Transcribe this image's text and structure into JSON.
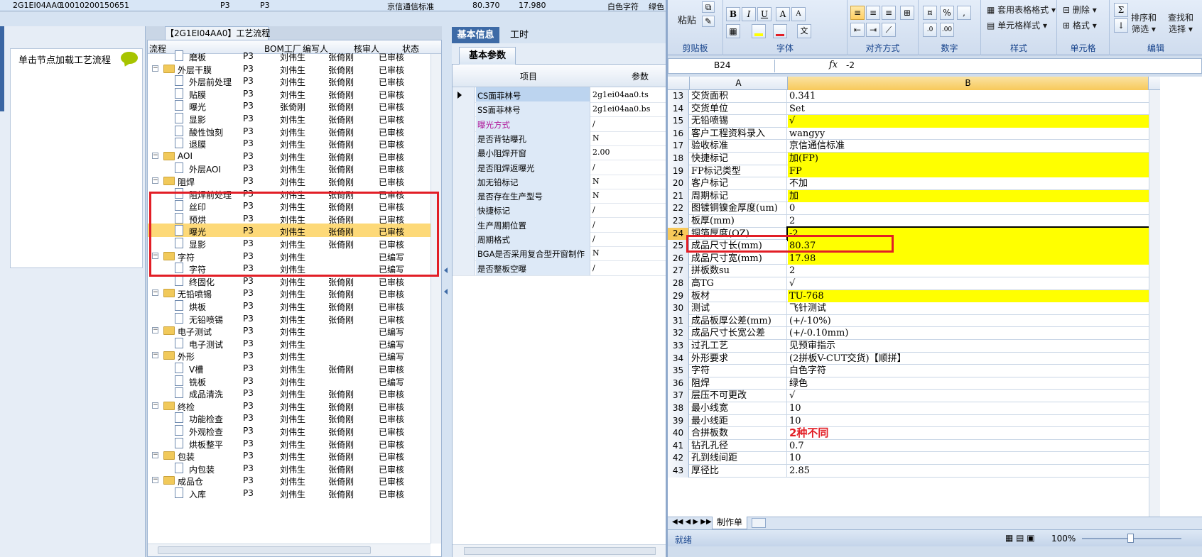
{
  "top_strip": {
    "code": "2G1EI04AA0",
    "number": "10010200150651",
    "p1": "P3",
    "p2": "P3",
    "standard": "京信通信标准",
    "v1": "80.370",
    "v2": "17.980",
    "tail": "白色字符",
    "tail2": "绿色"
  },
  "left_panel": {
    "hint": "单击节点加载工艺流程"
  },
  "tree": {
    "title": "【2G1EI04AA0】工艺流程",
    "columns": [
      "流程",
      "BOM工厂",
      "编写人",
      "核审人",
      "状态"
    ],
    "rows": [
      {
        "name": "磨板",
        "level": 2,
        "folder": false,
        "bom": "P3",
        "writer": "刘伟生",
        "reviewer": "张倚刚",
        "status": "已审核"
      },
      {
        "name": "外层干膜",
        "level": 1,
        "folder": true,
        "bom": "P3",
        "writer": "刘伟生",
        "reviewer": "张倚刚",
        "status": "已审核"
      },
      {
        "name": "外层前处理",
        "level": 2,
        "folder": false,
        "bom": "P3",
        "writer": "刘伟生",
        "reviewer": "张倚刚",
        "status": "已审核"
      },
      {
        "name": "贴膜",
        "level": 2,
        "folder": false,
        "bom": "P3",
        "writer": "刘伟生",
        "reviewer": "张倚刚",
        "status": "已审核"
      },
      {
        "name": "曝光",
        "level": 2,
        "folder": false,
        "bom": "P3",
        "writer": "张倚刚",
        "reviewer": "张倚刚",
        "status": "已审核"
      },
      {
        "name": "显影",
        "level": 2,
        "folder": false,
        "bom": "P3",
        "writer": "刘伟生",
        "reviewer": "张倚刚",
        "status": "已审核"
      },
      {
        "name": "酸性蚀刻",
        "level": 2,
        "folder": false,
        "bom": "P3",
        "writer": "刘伟生",
        "reviewer": "张倚刚",
        "status": "已审核"
      },
      {
        "name": "退膜",
        "level": 2,
        "folder": false,
        "bom": "P3",
        "writer": "刘伟生",
        "reviewer": "张倚刚",
        "status": "已审核"
      },
      {
        "name": "AOI",
        "level": 1,
        "folder": true,
        "bom": "P3",
        "writer": "刘伟生",
        "reviewer": "张倚刚",
        "status": "已审核"
      },
      {
        "name": "外层AOI",
        "level": 2,
        "folder": false,
        "bom": "P3",
        "writer": "刘伟生",
        "reviewer": "张倚刚",
        "status": "已审核"
      },
      {
        "name": "阻焊",
        "level": 1,
        "folder": true,
        "bom": "P3",
        "writer": "刘伟生",
        "reviewer": "张倚刚",
        "status": "已审核"
      },
      {
        "name": "阻焊前处理",
        "level": 2,
        "folder": false,
        "bom": "P3",
        "writer": "刘伟生",
        "reviewer": "张倚刚",
        "status": "已审核"
      },
      {
        "name": "丝印",
        "level": 2,
        "folder": false,
        "bom": "P3",
        "writer": "刘伟生",
        "reviewer": "张倚刚",
        "status": "已审核"
      },
      {
        "name": "预烘",
        "level": 2,
        "folder": false,
        "bom": "P3",
        "writer": "刘伟生",
        "reviewer": "张倚刚",
        "status": "已审核"
      },
      {
        "name": "曝光",
        "level": 2,
        "folder": false,
        "bom": "P3",
        "writer": "刘伟生",
        "reviewer": "张倚刚",
        "status": "已审核",
        "selected": true
      },
      {
        "name": "显影",
        "level": 2,
        "folder": false,
        "bom": "P3",
        "writer": "刘伟生",
        "reviewer": "张倚刚",
        "status": "已审核"
      },
      {
        "name": "字符",
        "level": 1,
        "folder": true,
        "bom": "P3",
        "writer": "刘伟生",
        "reviewer": "",
        "status": "已编写"
      },
      {
        "name": "字符",
        "level": 2,
        "folder": false,
        "bom": "P3",
        "writer": "刘伟生",
        "reviewer": "",
        "status": "已编写"
      },
      {
        "name": "终固化",
        "level": 2,
        "folder": false,
        "bom": "P3",
        "writer": "刘伟生",
        "reviewer": "张倚刚",
        "status": "已审核"
      },
      {
        "name": "无铅喷锡",
        "level": 1,
        "folder": true,
        "bom": "P3",
        "writer": "刘伟生",
        "reviewer": "张倚刚",
        "status": "已审核"
      },
      {
        "name": "烘板",
        "level": 2,
        "folder": false,
        "bom": "P3",
        "writer": "刘伟生",
        "reviewer": "张倚刚",
        "status": "已审核"
      },
      {
        "name": "无铅喷锡",
        "level": 2,
        "folder": false,
        "bom": "P3",
        "writer": "刘伟生",
        "reviewer": "张倚刚",
        "status": "已审核"
      },
      {
        "name": "电子测试",
        "level": 1,
        "folder": true,
        "bom": "P3",
        "writer": "刘伟生",
        "reviewer": "",
        "status": "已编写"
      },
      {
        "name": "电子测试",
        "level": 2,
        "folder": false,
        "bom": "P3",
        "writer": "刘伟生",
        "reviewer": "",
        "status": "已编写"
      },
      {
        "name": "外形",
        "level": 1,
        "folder": true,
        "bom": "P3",
        "writer": "刘伟生",
        "reviewer": "",
        "status": "已编写"
      },
      {
        "name": "V槽",
        "level": 2,
        "folder": false,
        "bom": "P3",
        "writer": "刘伟生",
        "reviewer": "张倚刚",
        "status": "已审核"
      },
      {
        "name": "铣板",
        "level": 2,
        "folder": false,
        "bom": "P3",
        "writer": "刘伟生",
        "reviewer": "",
        "status": "已编写"
      },
      {
        "name": "成品清洗",
        "level": 2,
        "folder": false,
        "bom": "P3",
        "writer": "刘伟生",
        "reviewer": "张倚刚",
        "status": "已审核"
      },
      {
        "name": "终检",
        "level": 1,
        "folder": true,
        "bom": "P3",
        "writer": "刘伟生",
        "reviewer": "张倚刚",
        "status": "已审核"
      },
      {
        "name": "功能检查",
        "level": 2,
        "folder": false,
        "bom": "P3",
        "writer": "刘伟生",
        "reviewer": "张倚刚",
        "status": "已审核"
      },
      {
        "name": "外观检查",
        "level": 2,
        "folder": false,
        "bom": "P3",
        "writer": "刘伟生",
        "reviewer": "张倚刚",
        "status": "已审核"
      },
      {
        "name": "烘板整平",
        "level": 2,
        "folder": false,
        "bom": "P3",
        "writer": "刘伟生",
        "reviewer": "张倚刚",
        "status": "已审核"
      },
      {
        "name": "包装",
        "level": 1,
        "folder": true,
        "bom": "P3",
        "writer": "刘伟生",
        "reviewer": "张倚刚",
        "status": "已审核"
      },
      {
        "name": "内包装",
        "level": 2,
        "folder": false,
        "bom": "P3",
        "writer": "刘伟生",
        "reviewer": "张倚刚",
        "status": "已审核"
      },
      {
        "name": "成品仓",
        "level": 1,
        "folder": true,
        "bom": "P3",
        "writer": "刘伟生",
        "reviewer": "张倚刚",
        "status": "已审核"
      },
      {
        "name": "入库",
        "level": 2,
        "folder": false,
        "bom": "P3",
        "writer": "刘伟生",
        "reviewer": "张倚刚",
        "status": "已审核"
      }
    ]
  },
  "params": {
    "tabs": [
      "基本信息",
      "工时"
    ],
    "subtab": "基本参数",
    "columns": [
      "项目",
      "参数"
    ],
    "rows": [
      {
        "label": "CS面菲林号",
        "value": "2g1ei04aa0.ts",
        "selected": true
      },
      {
        "label": "SS面菲林号",
        "value": "2g1ei04aa0.bs"
      },
      {
        "label": "曝光方式",
        "value": "/",
        "accent": true
      },
      {
        "label": "是否背钻曝孔",
        "value": "N"
      },
      {
        "label": "最小阻焊开窗",
        "value": "2.00"
      },
      {
        "label": "是否阻焊返曝光",
        "value": "/"
      },
      {
        "label": "加无铅标记",
        "value": "N"
      },
      {
        "label": "是否存在生产型号",
        "value": "N"
      },
      {
        "label": "快捷标记",
        "value": "/"
      },
      {
        "label": "生产周期位置",
        "value": "/"
      },
      {
        "label": "周期格式",
        "value": "/"
      },
      {
        "label": "BGA是否采用复合型开窗制作",
        "value": "N"
      },
      {
        "label": "是否整板空曝",
        "value": "/"
      }
    ]
  },
  "excel": {
    "ribbon": {
      "paste": "粘贴",
      "groups": [
        "剪贴板",
        "字体",
        "对齐方式",
        "数字",
        "样式",
        "单元格",
        "编辑"
      ],
      "styles_btn1": "套用表格格式",
      "styles_btn2": "单元格样式",
      "cells_btn1": "删除",
      "cells_btn2": "格式",
      "edit_btn1": "排序和",
      "edit_btn1b": "筛选",
      "edit_btn2": "查找和",
      "edit_btn2b": "选择",
      "font_color": "#e21e26",
      "fill_color": "#ffff00"
    },
    "namebox": "B24",
    "fx": "fx",
    "formula": "-2",
    "columns": [
      "A",
      "B"
    ],
    "rows": [
      {
        "n": "13",
        "a": "交货面积",
        "b": "0.341",
        "yellow": false
      },
      {
        "n": "14",
        "a": "交货单位",
        "b": "Set",
        "yellow": false
      },
      {
        "n": "15",
        "a": "无铅喷锡",
        "b": "√",
        "yellow": true
      },
      {
        "n": "16",
        "a": "客户工程资料录入",
        "b": "wangyy",
        "yellow": false
      },
      {
        "n": "17",
        "a": "验收标准",
        "b": "京信通信标准",
        "yellow": false
      },
      {
        "n": "18",
        "a": "快捷标记",
        "b": "加(FP)",
        "yellow": true
      },
      {
        "n": "19",
        "a": "FP标记类型",
        "b": "FP",
        "yellow": true
      },
      {
        "n": "20",
        "a": "客户标记",
        "b": "不加",
        "yellow": false
      },
      {
        "n": "21",
        "a": "周期标记",
        "b": "加",
        "yellow": true
      },
      {
        "n": "22",
        "a": "图镀铜镍金厚度(um)",
        "b": "0",
        "yellow": false
      },
      {
        "n": "23",
        "a": "板厚(mm)",
        "b": "2",
        "yellow": false
      },
      {
        "n": "24",
        "a": "铜箔厚度(OZ)",
        "b": "-2",
        "yellow": true,
        "active": true
      },
      {
        "n": "25",
        "a": "成品尺寸长(mm)",
        "b": "80.37",
        "yellow": true
      },
      {
        "n": "26",
        "a": "成品尺寸宽(mm)",
        "b": "17.98",
        "yellow": true
      },
      {
        "n": "27",
        "a": "拼板数su",
        "b": "2",
        "yellow": false
      },
      {
        "n": "28",
        "a": "高TG",
        "b": "√",
        "yellow": false
      },
      {
        "n": "29",
        "a": "板材",
        "b": "TU-768",
        "yellow": true
      },
      {
        "n": "30",
        "a": "测试",
        "b": "飞针测试",
        "yellow": false
      },
      {
        "n": "31",
        "a": "成品板厚公差(mm)",
        "b": "(+/-10%)",
        "yellow": false
      },
      {
        "n": "32",
        "a": "成品尺寸长宽公差",
        "b": "(+/-0.10mm)",
        "yellow": false
      },
      {
        "n": "33",
        "a": "过孔工艺",
        "b": "见预审指示",
        "yellow": false
      },
      {
        "n": "34",
        "a": "外形要求",
        "b": "(2拼板V-CUT交货)【顺拼】",
        "yellow": false
      },
      {
        "n": "35",
        "a": "字符",
        "b": "白色字符",
        "yellow": false
      },
      {
        "n": "36",
        "a": "阻焊",
        "b": "绿色",
        "yellow": false
      },
      {
        "n": "37",
        "a": "层压不可更改",
        "b": "√",
        "yellow": false
      },
      {
        "n": "38",
        "a": "最小线宽",
        "b": "10",
        "yellow": false
      },
      {
        "n": "39",
        "a": "最小线距",
        "b": "10",
        "yellow": false
      },
      {
        "n": "40",
        "a": "合拼板数",
        "b": "2种不同",
        "yellow": false,
        "big": true
      },
      {
        "n": "41",
        "a": "钻孔孔径",
        "b": "0.7",
        "yellow": false
      },
      {
        "n": "42",
        "a": "孔到线间距",
        "b": "10",
        "yellow": false
      },
      {
        "n": "43",
        "a": "厚径比",
        "b": "2.85",
        "yellow": false
      }
    ],
    "sheet_tab": "制作单",
    "status": "就绪",
    "zoom": "100%",
    "zoom_level": 100
  }
}
